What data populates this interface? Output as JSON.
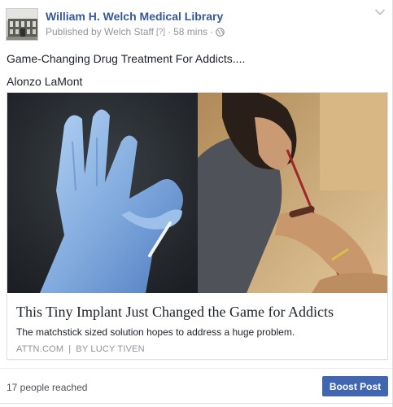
{
  "post": {
    "page_name": "William H. Welch Medical Library",
    "meta": {
      "published_by": "Published by Welch Staff",
      "help_marker": "[?]",
      "separator": "·",
      "time": "58 mins",
      "separator2": "·"
    },
    "text_lines": [
      "Game-Changing Drug Treatment For Addicts....",
      "Alonzo LaMont"
    ],
    "link_preview": {
      "title": "This Tiny Implant Just Changed the Game for Addicts",
      "description": "The matchstick sized solution hopes to address a huge problem.",
      "source": "ATTN.COM",
      "source_separator": "|",
      "byline": "BY LUCY TIVEN"
    }
  },
  "footer": {
    "reach": "17 people reached",
    "boost_label": "Boost Post"
  },
  "colors": {
    "link_blue": "#365899",
    "button_blue": "#4267b2",
    "meta_gray": "#90949c",
    "border": "#dddfe2"
  },
  "icons": [
    "chevron-down-icon",
    "globe-icon"
  ]
}
